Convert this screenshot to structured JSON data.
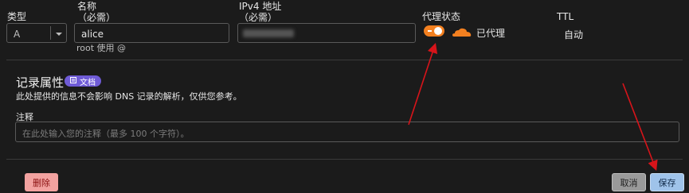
{
  "fields": {
    "type": {
      "label": "类型",
      "value": "A"
    },
    "name": {
      "label_line1": "名称",
      "label_line2": "（必需）",
      "value": "alice",
      "hint": "root 使用 @"
    },
    "ipv4": {
      "label_line1": "IPv4 地址",
      "label_line2": "（必需）"
    },
    "proxy": {
      "label": "代理状态",
      "status_text": "已代理"
    },
    "ttl": {
      "label": "TTL",
      "value": "自动"
    }
  },
  "record_attributes": {
    "title": "记录属性",
    "docs_badge": "文档",
    "description": "此处提供的信息不会影响 DNS 记录的解析，仅供您参考。",
    "comment_label": "注释",
    "comment_placeholder": "在此处输入您的注释（最多 100 个字符）。"
  },
  "actions": {
    "delete_label": "删除",
    "cancel_label": "取消",
    "save_label": "保存"
  },
  "colors": {
    "toggle_orange": "#f38020",
    "cloud_orange": "#f38020",
    "delete_bg": "#f2a2a0",
    "cancel_bg": "#9a9a9a",
    "save_bg": "#9fc3ea",
    "arrow_red": "#d8141a",
    "badge_purple": "#6f5bd6"
  }
}
